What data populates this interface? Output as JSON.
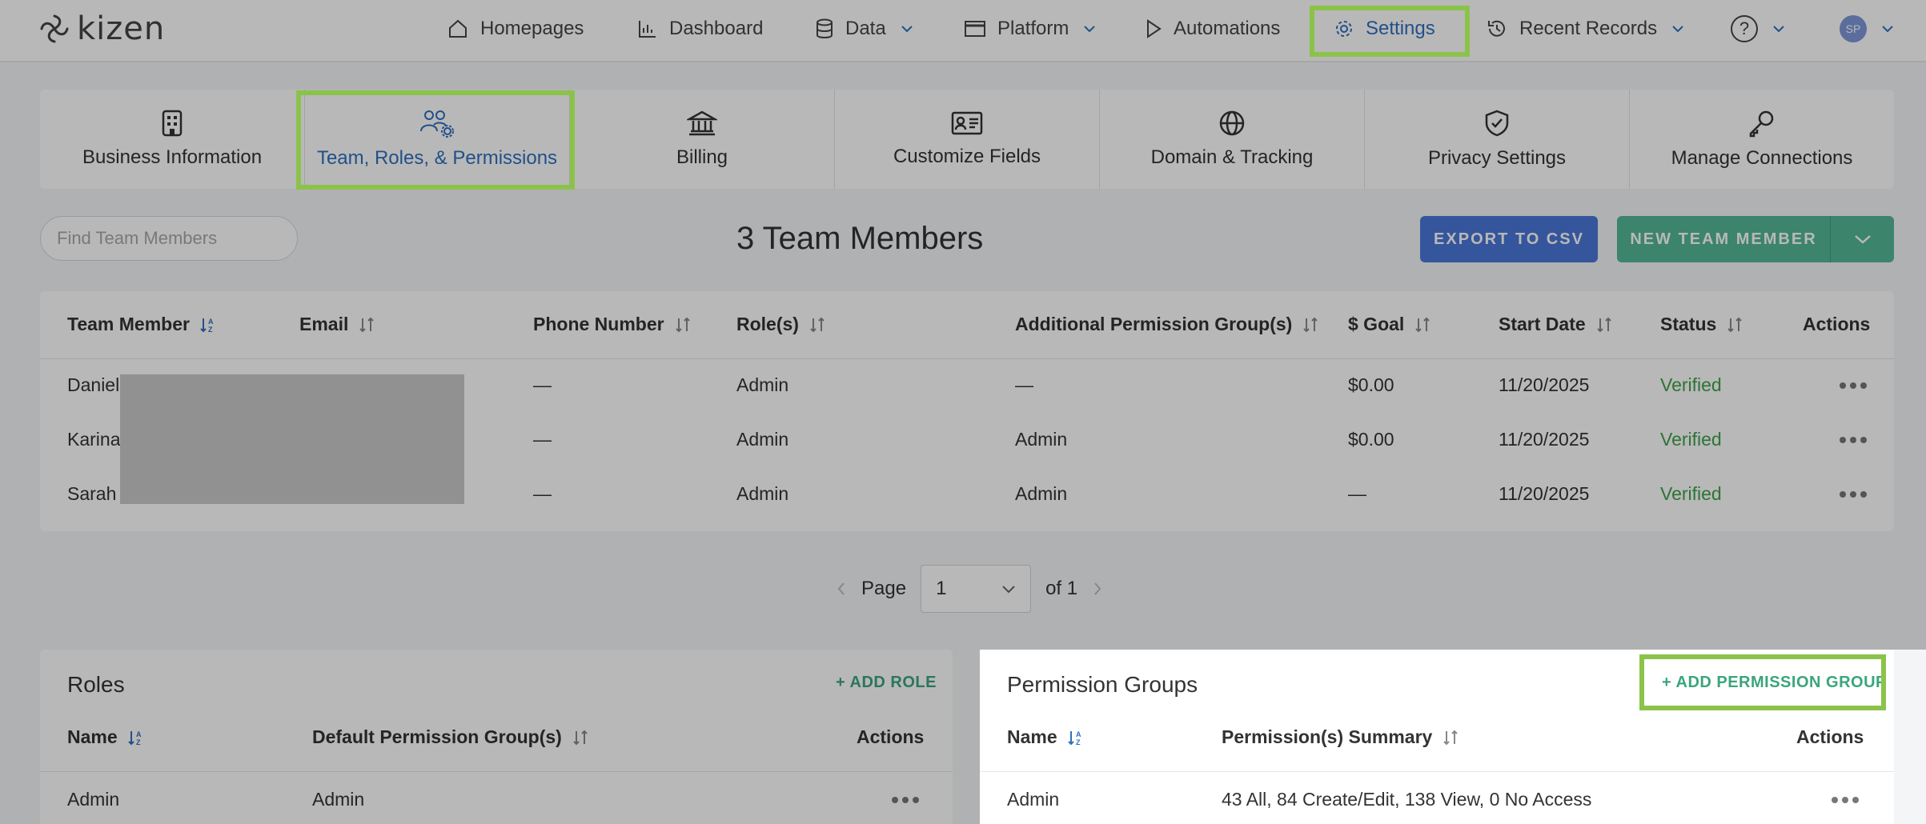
{
  "brand": {
    "logo_text": "kizen"
  },
  "nav": {
    "homepages": "Homepages",
    "dashboard": "Dashboard",
    "data": "Data",
    "platform": "Platform",
    "automations": "Automations",
    "settings": "Settings",
    "recent_records": "Recent Records",
    "help": "?",
    "avatar_initials": "SP"
  },
  "tabs": [
    {
      "label": "Business Information",
      "icon": "building-icon"
    },
    {
      "label": "Team, Roles, & Permissions",
      "icon": "team-gear-icon"
    },
    {
      "label": "Billing",
      "icon": "bank-icon"
    },
    {
      "label": "Customize Fields",
      "icon": "id-card-icon"
    },
    {
      "label": "Domain & Tracking",
      "icon": "globe-icon"
    },
    {
      "label": "Privacy Settings",
      "icon": "shield-check-icon"
    },
    {
      "label": "Manage Connections",
      "icon": "key-icon"
    }
  ],
  "search": {
    "placeholder": "Find Team Members"
  },
  "members_title": "3 Team Members",
  "buttons": {
    "export": "EXPORT TO CSV",
    "new_member": "NEW TEAM MEMBER"
  },
  "team_table": {
    "headers": {
      "member": "Team Member",
      "email": "Email",
      "phone": "Phone Number",
      "roles": "Role(s)",
      "additional": "Additional Permission Group(s)",
      "goal": "$ Goal",
      "start": "Start Date",
      "status": "Status",
      "actions": "Actions"
    },
    "rows": [
      {
        "member": "Daniel",
        "phone": "—",
        "roles": "Admin",
        "additional": "—",
        "goal": "$0.00",
        "start": "11/20/2025",
        "status": "Verified"
      },
      {
        "member": "Karina",
        "phone": "—",
        "roles": "Admin",
        "additional": "Admin",
        "goal": "$0.00",
        "start": "11/20/2025",
        "status": "Verified"
      },
      {
        "member": "Sarah",
        "phone": "—",
        "roles": "Admin",
        "additional": "Admin",
        "goal": "—",
        "start": "11/20/2025",
        "status": "Verified"
      }
    ]
  },
  "pagination": {
    "page_label": "Page",
    "page_value": "1",
    "of_label": "of 1"
  },
  "roles": {
    "title": "Roles",
    "add_link": "+ ADD ROLE",
    "headers": {
      "name": "Name",
      "default_group": "Default Permission Group(s)",
      "actions": "Actions"
    },
    "rows": [
      {
        "name": "Admin",
        "default_group": "Admin"
      }
    ]
  },
  "permission_groups": {
    "title": "Permission Groups",
    "add_link": "+ ADD PERMISSION GROUP",
    "headers": {
      "name": "Name",
      "summary": "Permission(s) Summary",
      "actions": "Actions"
    },
    "rows": [
      {
        "name": "Admin",
        "summary": "43 All, 84 Create/Edit, 138 View, 0 No Access"
      }
    ]
  },
  "colors": {
    "accent_blue": "#2f6fbf",
    "export_button": "#4a77d9",
    "new_member_button": "#54b796",
    "verified": "#3fa14a",
    "highlight": "#8bc34a"
  }
}
